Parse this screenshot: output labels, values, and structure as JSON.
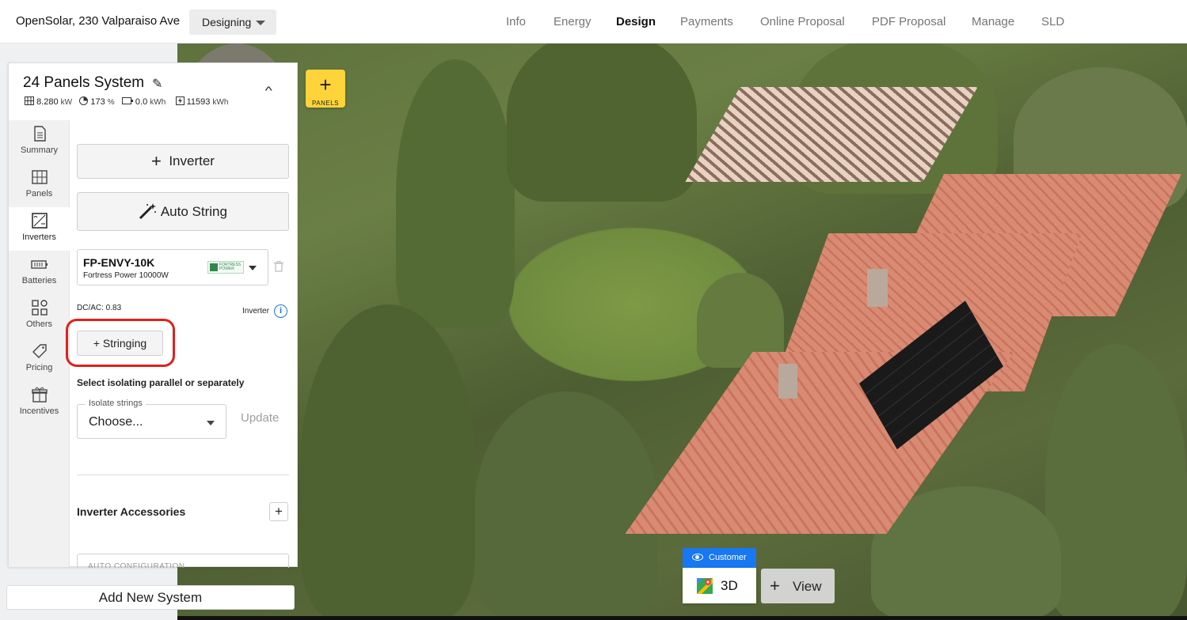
{
  "header": {
    "project_title": "OpenSolar, 230 Valparaiso Ave",
    "stage": "Designing",
    "nav": [
      "Info",
      "Energy",
      "Design",
      "Payments",
      "Online Proposal",
      "PDF Proposal",
      "Manage",
      "SLD"
    ],
    "active_nav": "Design"
  },
  "map": {
    "panels_button_label": "PANELS",
    "panels_button_color": "#ffd43b"
  },
  "system": {
    "title": "24 Panels System",
    "stats": {
      "kw_value": "8.280",
      "kw_unit": "kW",
      "offset_value": "173",
      "offset_unit": "%",
      "battery_value": "0.0",
      "battery_unit": "kWh",
      "production_value": "11593",
      "production_unit": "kWh"
    }
  },
  "tabs": [
    {
      "label": "Summary",
      "icon": "document-icon"
    },
    {
      "label": "Panels",
      "icon": "grid-icon"
    },
    {
      "label": "Inverters",
      "icon": "inverter-icon"
    },
    {
      "label": "Batteries",
      "icon": "battery-icon"
    },
    {
      "label": "Others",
      "icon": "apps-icon"
    },
    {
      "label": "Pricing",
      "icon": "tag-icon"
    },
    {
      "label": "Incentives",
      "icon": "gift-icon"
    }
  ],
  "active_tab": "Inverters",
  "inverters": {
    "add_inverter_label": "Inverter",
    "auto_string_label": "Auto String",
    "selected": {
      "model": "FP-ENVY-10K",
      "description": "Fortress Power 10000W",
      "logo_text": "FORTRESS POWER"
    },
    "dcac_label": "DC/AC: 0.83",
    "info_label": "Inverter",
    "stringing_label": "+ Stringing",
    "isolate_hint": "Select isolating parallel or separately",
    "isolate_field_label": "Isolate strings",
    "isolate_value": "Choose...",
    "update_label": "Update",
    "accessories_label": "Inverter Accessories",
    "accessories_add": "+",
    "auto_config_label": "AUTO CONFIGURATION"
  },
  "footer": {
    "add_system_label": "Add New System"
  },
  "view_controls": {
    "customer_label": "Customer",
    "mode_3d": "3D",
    "view_label": "View"
  },
  "colors": {
    "accent_blue": "#1877f2",
    "highlight_red": "#e0201c",
    "info_blue": "#1a73e8"
  }
}
